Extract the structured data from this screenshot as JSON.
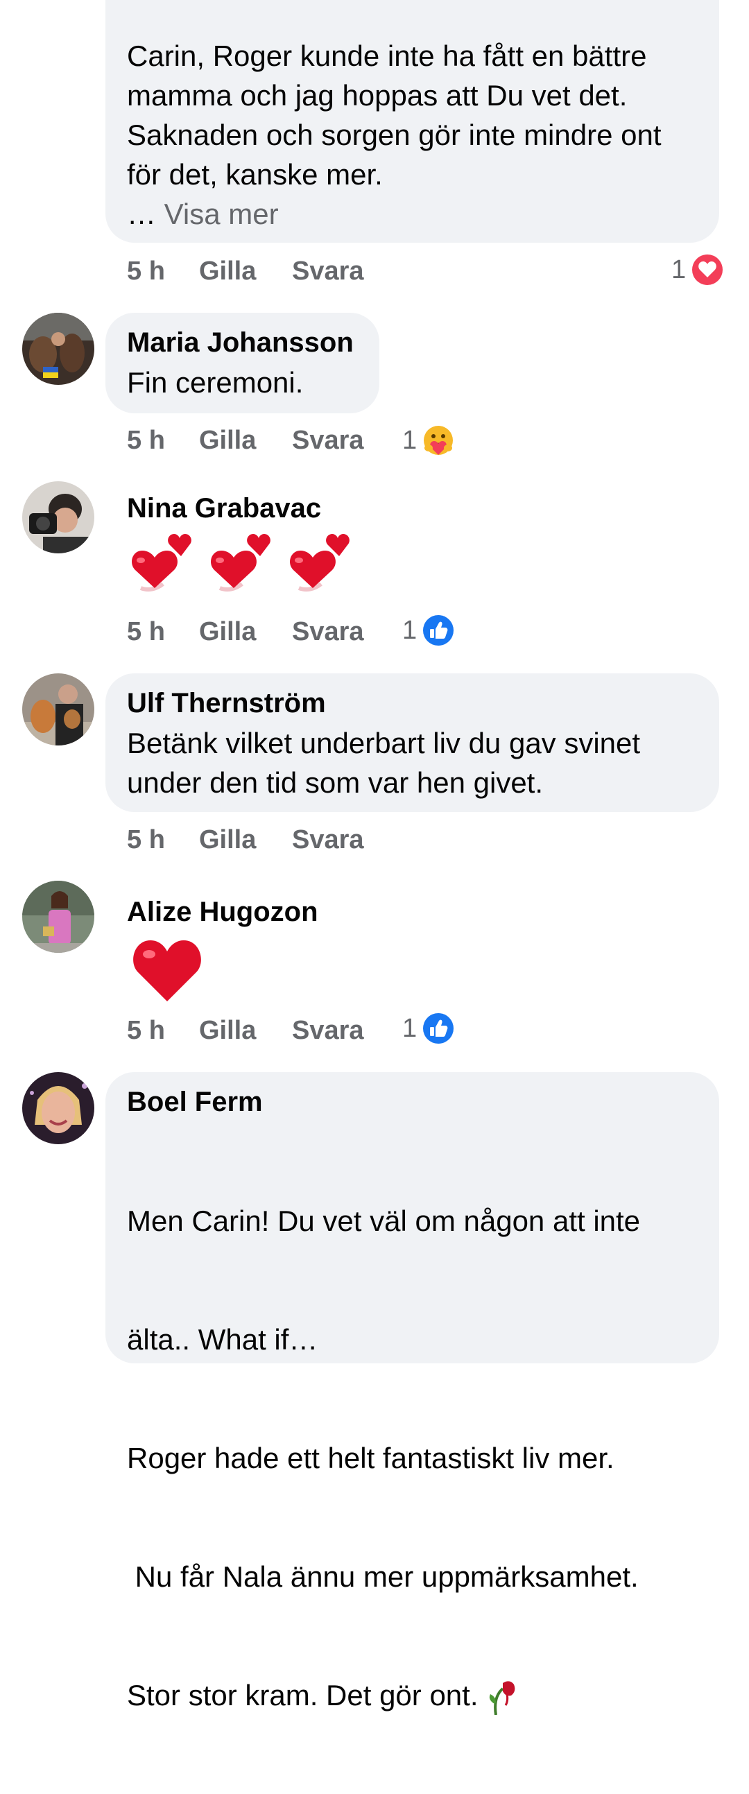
{
  "comments": [
    {
      "name": "",
      "lines": [
        "Carin, Roger kunde inte ha fått en bättre",
        "mamma och jag hoppas att Du vet det.",
        "Saknaden och sorgen gör inte mindre ont",
        "för det, kanske mer."
      ],
      "ellipsis": "… ",
      "more": "Visa mer",
      "time": "5 h",
      "like": "Gilla",
      "reply": "Svara",
      "reaction_count": "1",
      "reaction": "love-reaction-icon"
    },
    {
      "name": "Maria Johansson",
      "lines": [
        "Fin ceremoni."
      ],
      "time": "5 h",
      "like": "Gilla",
      "reply": "Svara",
      "reaction_count": "1",
      "reaction": "care-reaction-icon"
    },
    {
      "name": "Nina Grabavac",
      "content": "three-two-hearts-emoji",
      "time": "5 h",
      "like": "Gilla",
      "reply": "Svara",
      "reaction_count": "1",
      "reaction": "like-reaction-icon"
    },
    {
      "name": "Ulf Thernström",
      "lines": [
        "Betänk vilket underbart liv du gav svinet",
        "under den tid som var hen givet."
      ],
      "time": "5 h",
      "like": "Gilla",
      "reply": "Svara"
    },
    {
      "name": "Alize Hugozon",
      "content": "red-heart-emoji",
      "time": "5 h",
      "like": "Gilla",
      "reply": "Svara",
      "reaction_count": "1",
      "reaction": "like-reaction-icon"
    },
    {
      "name": "Boel Ferm",
      "lines": [
        "Men Carin! Du vet väl om någon att inte",
        "älta.. What if…",
        "Roger hade ett helt fantastiskt liv mer.",
        " Nu får Nala ännu mer uppmärksamhet.",
        "Stor stor kram. Det gör ont. "
      ],
      "trailing_emoji": "wilted-flower-emoji"
    }
  ],
  "colors": {
    "bubble": "#f0f2f5",
    "secondary_text": "#65676b",
    "love": "#f33e58",
    "like": "#1877f2",
    "heart": "#e0102a"
  }
}
